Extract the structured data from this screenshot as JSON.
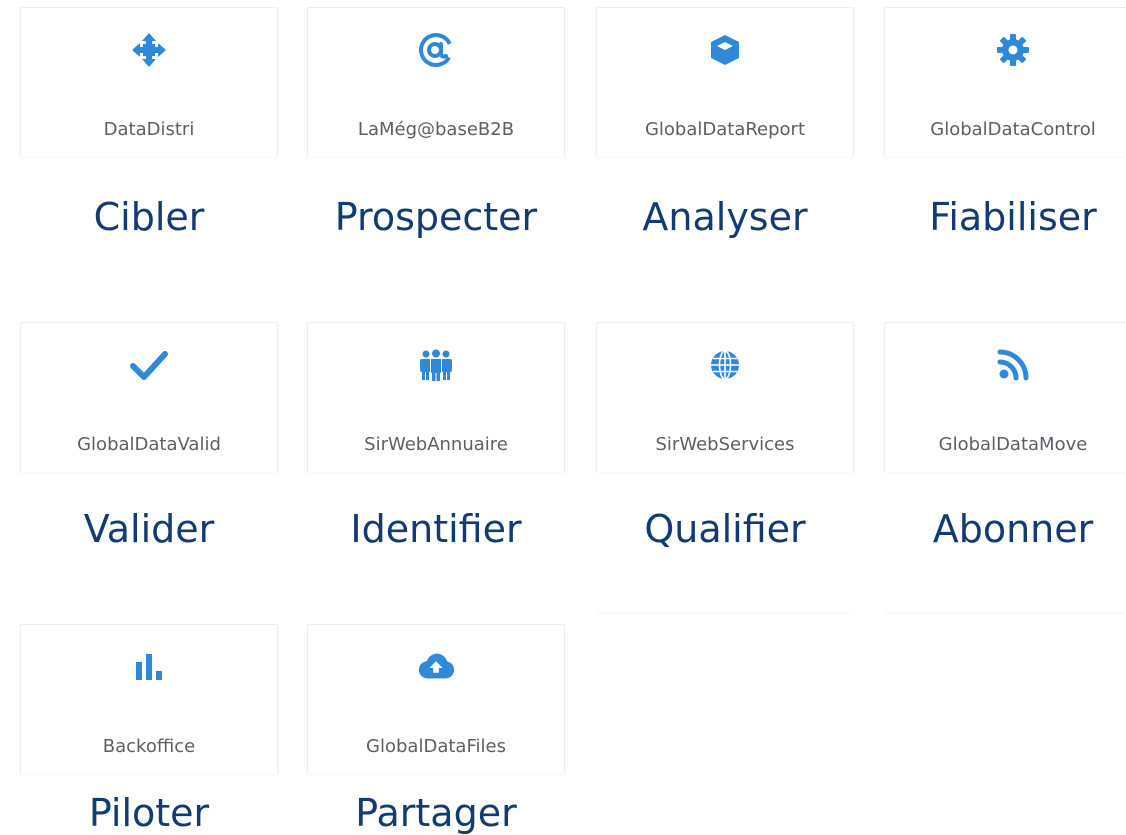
{
  "accent": "#2f88d8",
  "caption_color": "#113b74",
  "products": [
    {
      "name": "DataDistri",
      "caption": "Cibler",
      "icon": "arrows-move-icon"
    },
    {
      "name": "LaMég@baseB2B",
      "caption": "Prospecter",
      "icon": "at-sign-icon"
    },
    {
      "name": "GlobalDataReport",
      "caption": "Analyser",
      "icon": "cube-icon"
    },
    {
      "name": "GlobalDataControl",
      "caption": "Fiabiliser",
      "icon": "gear-icon"
    },
    {
      "name": "GlobalDataValid",
      "caption": "Valider",
      "icon": "checkmark-icon"
    },
    {
      "name": "SirWebAnnuaire",
      "caption": "Identifier",
      "icon": "users-icon"
    },
    {
      "name": "SirWebServices",
      "caption": "Qualifier",
      "icon": "globe-icon"
    },
    {
      "name": "GlobalDataMove",
      "caption": "Abonner",
      "icon": "rss-icon"
    },
    {
      "name": "Backoffice",
      "caption": "Piloter",
      "icon": "bar-chart-icon"
    },
    {
      "name": "GlobalDataFiles",
      "caption": "Partager",
      "icon": "cloud-upload-icon"
    }
  ]
}
